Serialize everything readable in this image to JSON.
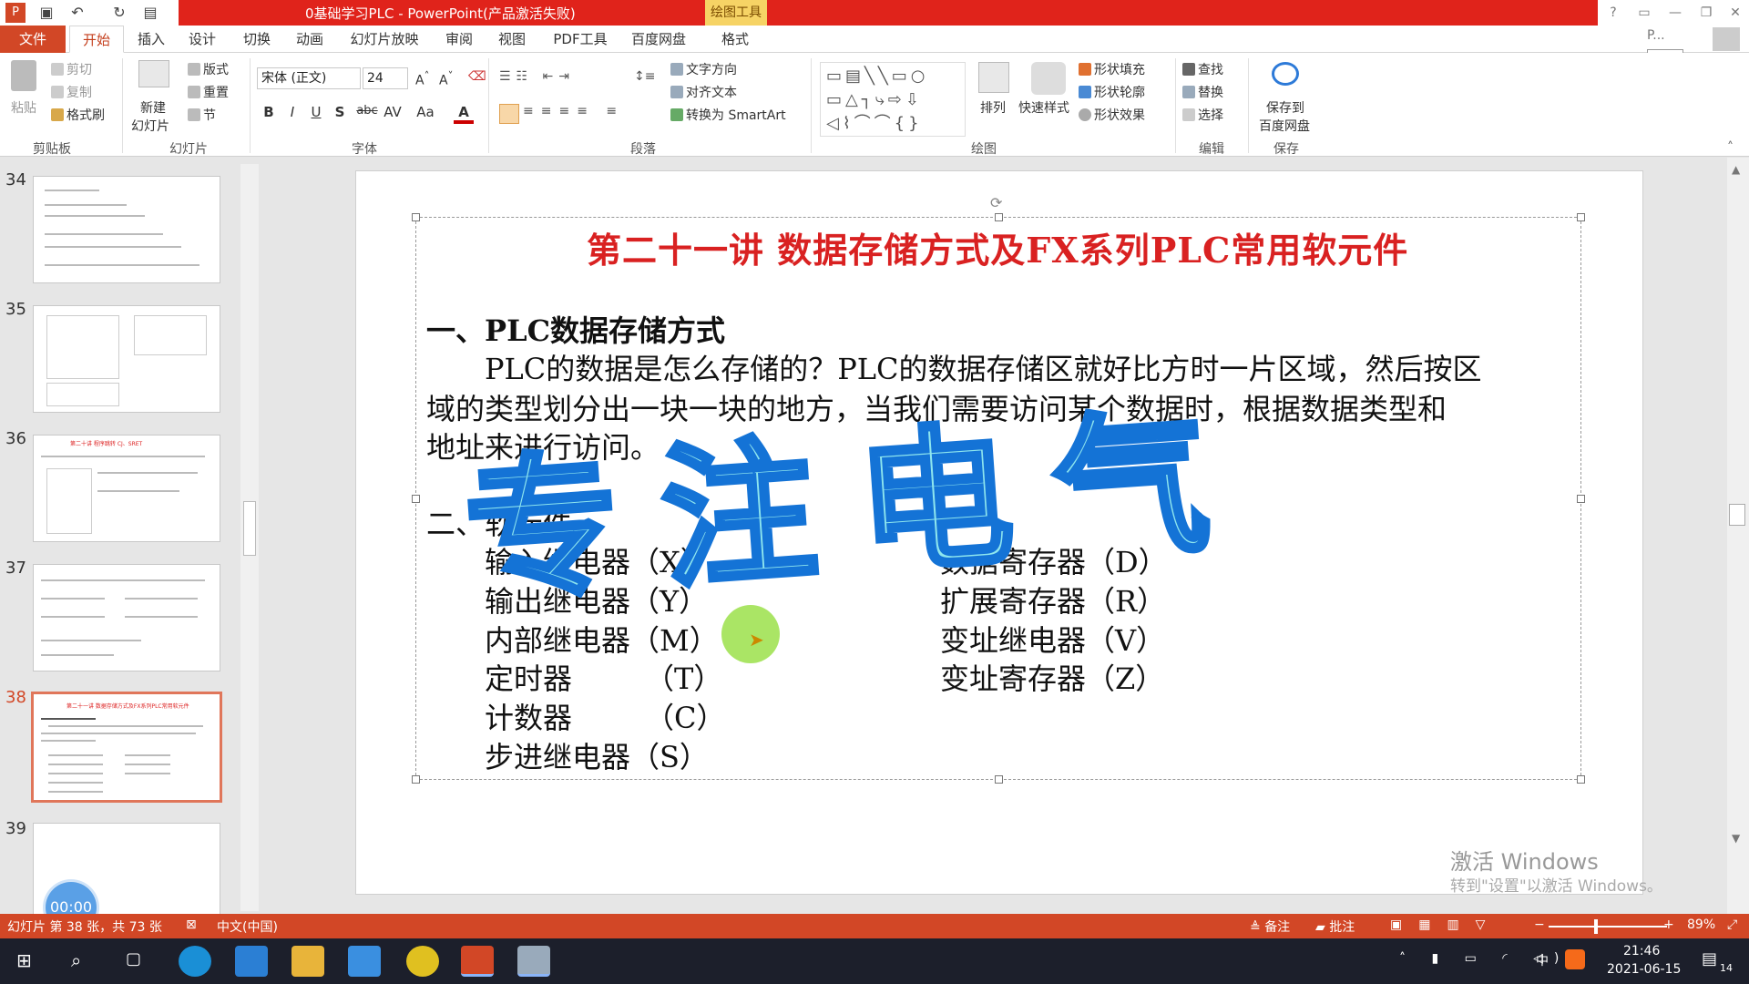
{
  "titlebar": {
    "title": "0基础学习PLC - PowerPoint(产品激活失败)",
    "context_tab": "绘图工具",
    "help": "?",
    "signin": "P...",
    "start_tooltip": "开始"
  },
  "tabs": [
    "文件",
    "开始",
    "插入",
    "设计",
    "切换",
    "动画",
    "幻灯片放映",
    "审阅",
    "视图",
    "PDF工具",
    "百度网盘",
    "格式"
  ],
  "ribbon": {
    "clipboard": {
      "paste": "粘贴",
      "cut": "剪切",
      "copy": "复制",
      "painter": "格式刷",
      "label": "剪贴板"
    },
    "slides": {
      "new": "新建",
      "new2": "幻灯片",
      "layout": "版式",
      "reset": "重置",
      "section": "节",
      "label": "幻灯片"
    },
    "font": {
      "name": "宋体 (正文)",
      "size": "24",
      "label": "字体",
      "bold": "B",
      "italic": "I",
      "underline": "U",
      "shadow": "S",
      "strike": "abc",
      "spacing": "AV",
      "case": "Aa",
      "color": "A"
    },
    "paragraph": {
      "direction": "文字方向",
      "align": "对齐文本",
      "smartart": "转换为 SmartArt",
      "label": "段落"
    },
    "drawing": {
      "arrange": "排列",
      "quickstyles": "快速样式",
      "fill": "形状填充",
      "outline": "形状轮廓",
      "effects": "形状效果",
      "label": "绘图"
    },
    "editing": {
      "find": "查找",
      "replace": "替换",
      "select": "选择",
      "label": "编辑"
    },
    "save": {
      "line1": "保存到",
      "line2": "百度网盘",
      "label": "保存"
    }
  },
  "slides_pane": {
    "numbers": [
      "34",
      "35",
      "36",
      "37",
      "38",
      "39"
    ],
    "selected": "38",
    "thumb38_title": "第二十一讲 数据存储方式及FX系列PLC常用软元件",
    "thumb36_title": "第二十讲 程序跳转 CJ、SRET"
  },
  "slide": {
    "title": "第二十一讲 数据存储方式及FX系列PLC常用软元件",
    "section1": "一、PLC数据存储方式",
    "para_line1": "PLC的数据是怎么存储的？PLC的数据存储区就好比方时一片区域，然后按区",
    "para_line2": "域的类型划分出一块一块的地方，当我们需要访问某个数据时，根据数据类型和",
    "para_line3": "地址来进行访问。",
    "section2": "二、软元件",
    "left_items": [
      "输入继电器（X）",
      "输出继电器（Y）",
      "内部继电器（M）",
      "定时器　　　（T）",
      "计数器　　　（C）",
      "步进继电器（S）"
    ],
    "right_items": [
      "数据寄存器（D）",
      "扩展寄存器（R）",
      "变址继电器（V）",
      "变址寄存器（Z）"
    ],
    "watermark": "专注电气"
  },
  "overlay": {
    "timer": "00:00",
    "activate1": "激活 Windows",
    "activate2": "转到\"设置\"以激活 Windows。"
  },
  "statusbar": {
    "slide_info": "幻灯片 第 38 张，共 73 张",
    "language": "中文(中国)",
    "notes": "备注",
    "comments": "批注",
    "zoom": "89%"
  },
  "taskbar": {
    "time": "21:46",
    "date": "2021-06-15",
    "ime": "中",
    "notif": "14"
  }
}
